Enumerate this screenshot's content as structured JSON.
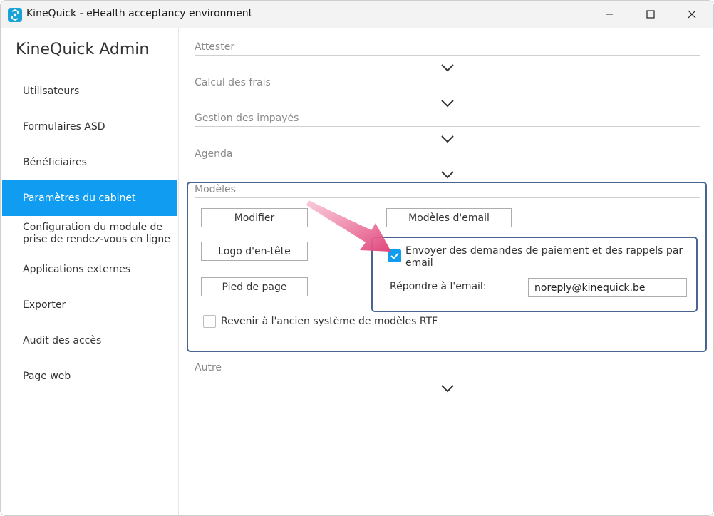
{
  "window": {
    "title": "KineQuick - eHealth acceptancy environment",
    "icon": "kinequick-app-icon"
  },
  "sidebar": {
    "title": "KineQuick Admin",
    "items": [
      {
        "label": "Utilisateurs"
      },
      {
        "label": "Formulaires ASD"
      },
      {
        "label": "Bénéficiaires"
      },
      {
        "label": "Paramètres du cabinet"
      },
      {
        "label": "Configuration du module de prise de rendez-vous en ligne",
        "line1": "Configuration du module de",
        "line2": "prise de rendez-vous en ligne"
      },
      {
        "label": "Applications externes"
      },
      {
        "label": "Exporter"
      },
      {
        "label": "Audit des accès"
      },
      {
        "label": "Page web"
      }
    ],
    "active": "Paramètres du cabinet"
  },
  "sections": [
    {
      "label": "Attester"
    },
    {
      "label": "Calcul des frais"
    },
    {
      "label": "Gestion des impayés"
    },
    {
      "label": "Agenda"
    },
    {
      "label": "Modèles"
    },
    {
      "label": "Autre"
    }
  ],
  "models": {
    "modify_button": "Modifier",
    "email_models_button": "Modèles d'email",
    "header_logo_button": "Logo d'en-tête",
    "footer_button": "Pied de page",
    "rtf_checkbox": {
      "label": "Revenir à l'ancien système de modèles RTF",
      "checked": false
    },
    "email_checkbox": {
      "line1": "Envoyer des demandes de paiement et des rappels par",
      "line2": "email",
      "checked": true
    },
    "reply_label": "Répondre à l'email:",
    "reply_email": "noreply@kinequick.be"
  },
  "colors": {
    "accent": "#109cf1",
    "highlight_frame": "#4a6491",
    "annotation_arrow": "#e0457b"
  }
}
